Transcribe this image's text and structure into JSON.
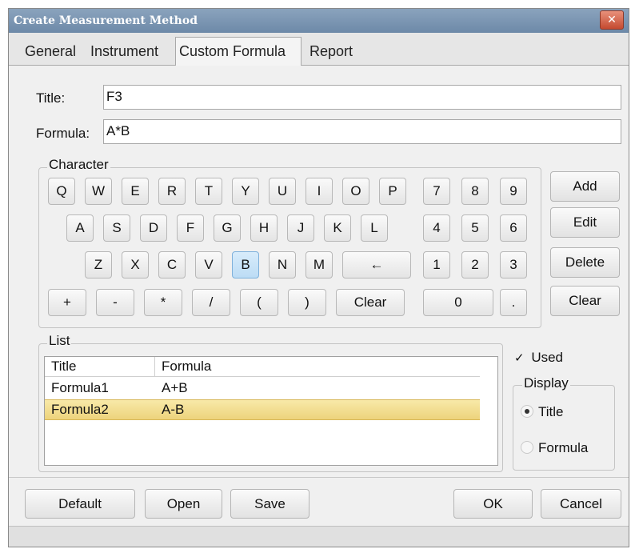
{
  "window": {
    "title": "Create Measurement Method",
    "close_glyph": "✕"
  },
  "tabs": [
    {
      "label": "General",
      "active": false
    },
    {
      "label": "Instrument",
      "active": false
    },
    {
      "label": "Custom Formula",
      "active": true
    },
    {
      "label": "Report",
      "active": false
    }
  ],
  "form": {
    "title_label": "Title:",
    "title_value": "F3",
    "formula_label": "Formula:",
    "formula_value": "A*B"
  },
  "character": {
    "group_label": "Character",
    "letter_rows": [
      [
        "Q",
        "W",
        "E",
        "R",
        "T",
        "Y",
        "U",
        "I",
        "O",
        "P"
      ],
      [
        "A",
        "S",
        "D",
        "F",
        "G",
        "H",
        "J",
        "K",
        "L"
      ],
      [
        "Z",
        "X",
        "C",
        "V",
        "B",
        "N",
        "M",
        "←"
      ],
      [
        "+",
        "-",
        "*",
        "/",
        "(",
        ")",
        "Clear"
      ]
    ],
    "digit_rows": [
      [
        "7",
        "8",
        "9"
      ],
      [
        "4",
        "5",
        "6"
      ],
      [
        "1",
        "2",
        "3"
      ],
      [
        "0",
        "."
      ]
    ],
    "selected_key": "B"
  },
  "side_buttons": [
    "Add",
    "Edit",
    "Delete",
    "Clear"
  ],
  "list": {
    "group_label": "List",
    "columns": [
      "Title",
      "Formula"
    ],
    "rows": [
      {
        "title": "Formula1",
        "formula": "A+B",
        "selected": false
      },
      {
        "title": "Formula2",
        "formula": "A-B",
        "selected": true
      }
    ]
  },
  "options": {
    "used_label": "Used",
    "used_checked": true,
    "display_label": "Display",
    "display_options": [
      {
        "label": "Title",
        "selected": true
      },
      {
        "label": "Formula",
        "selected": false
      }
    ]
  },
  "bottom_buttons": {
    "default": "Default",
    "open": "Open",
    "save": "Save",
    "ok": "OK",
    "cancel": "Cancel"
  },
  "colors": {
    "titlebar": "#7a95b3",
    "close": "#c54a30",
    "selection": "#f1dc8e",
    "selected_key": "#c8e2f7"
  }
}
